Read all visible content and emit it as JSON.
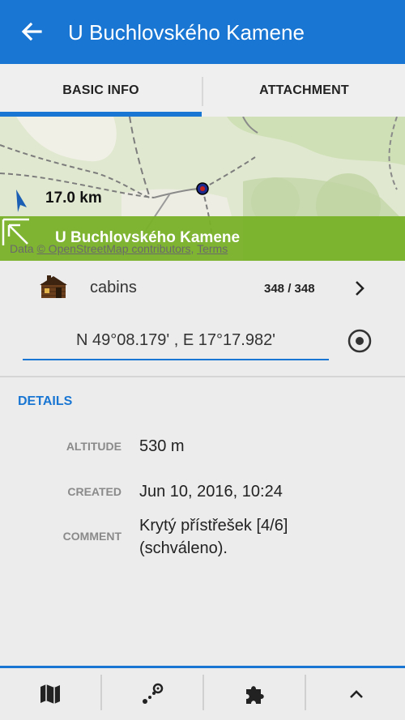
{
  "header": {
    "title": "U Buchlovského Kamene",
    "back_icon": "arrow-left-icon"
  },
  "tabs": [
    {
      "label": "BASIC INFO",
      "active": true
    },
    {
      "label": "ATTACHMENT",
      "active": false
    }
  ],
  "map": {
    "distance": "17.0 km",
    "banner_title": "U Buchlovského Kamene",
    "attribution_prefix": "Data ",
    "attribution_link": "© OpenStreetMap contributors",
    "attribution_sep": ", ",
    "attribution_terms": "Terms",
    "banner_color": "#78b128"
  },
  "category": {
    "icon": "cabin-icon",
    "label": "cabins",
    "count": "348 / 348"
  },
  "coordinates": {
    "value": "N 49°08.179' , E 17°17.982'"
  },
  "details": {
    "heading": "DETAILS",
    "rows": [
      {
        "label": "ALTITUDE",
        "value": "530 m"
      },
      {
        "label": "CREATED",
        "value": "Jun 10, 2016, 10:24"
      },
      {
        "label": "COMMENT",
        "value_line1": "Krytý přístřešek [4/6]",
        "value_line2": "(schváleno)."
      }
    ]
  },
  "bottom_nav": [
    "map-icon",
    "route-icon",
    "addons-icon",
    "chevron-up-icon"
  ],
  "colors": {
    "accent": "#1976d2",
    "background": "#ececec"
  }
}
